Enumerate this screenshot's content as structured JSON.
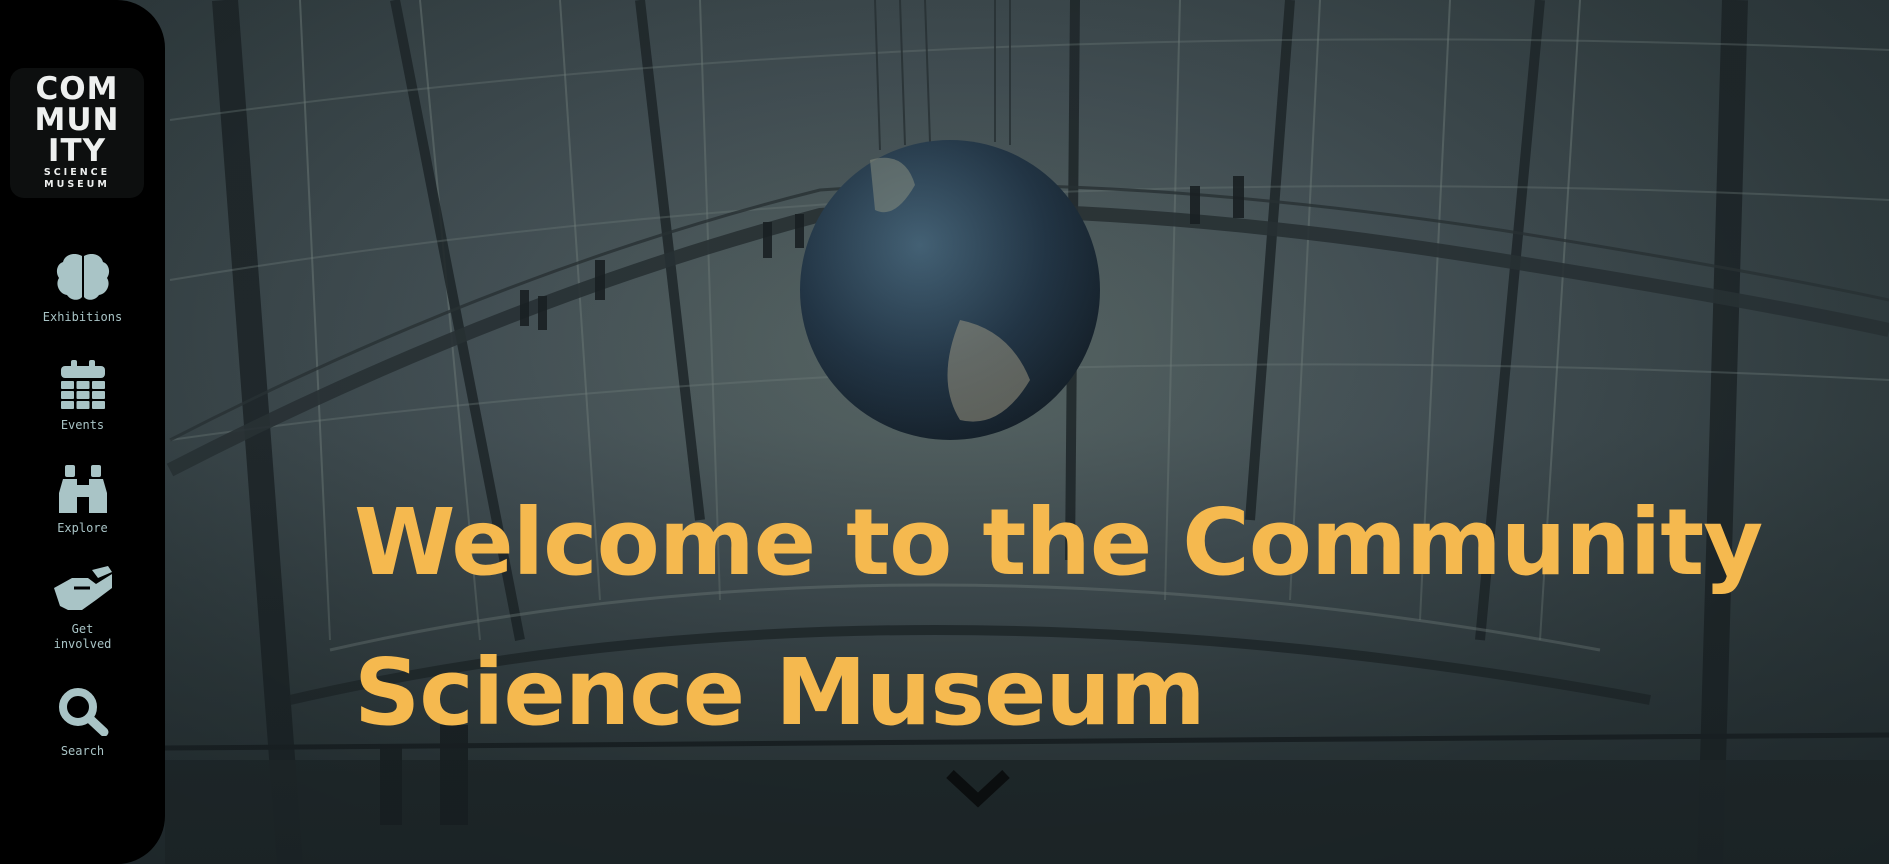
{
  "logo": {
    "word_lines": [
      "COM",
      "MUN",
      "ITY"
    ],
    "sub_lines": [
      "SCIENCE",
      "MUSEUM"
    ]
  },
  "nav": [
    {
      "label": "Exhibitions",
      "icon": "brain-icon"
    },
    {
      "label": "Events",
      "icon": "calendar-icon"
    },
    {
      "label": "Explore",
      "icon": "binoculars-icon"
    },
    {
      "label": "Get\ninvolved",
      "icon": "handshake-icon"
    },
    {
      "label": "Search",
      "icon": "search-icon"
    }
  ],
  "hero": {
    "headline": "Welcome to the Community Science Museum",
    "scroll_icon": "chevron-down-icon"
  },
  "colors": {
    "sidebar_bg": "#000000",
    "icon": "#a9c4c6",
    "headline": "#f5b94f",
    "logo_text": "#eef0ef"
  }
}
